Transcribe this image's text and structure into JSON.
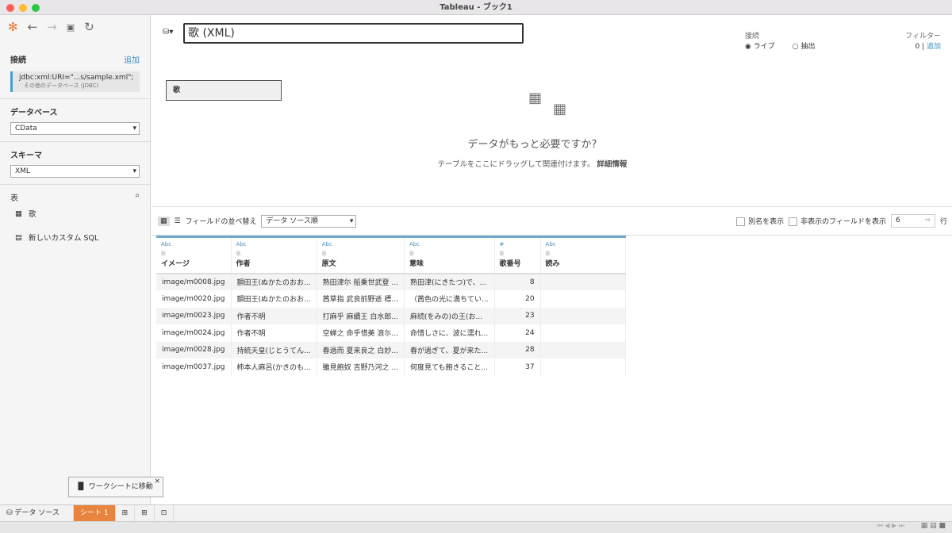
{
  "window": {
    "title": "Tableau - ブック1"
  },
  "sidebar": {
    "connections_label": "接続",
    "add_label": "追加",
    "connection": {
      "name": "jdbc:xml:URI=\"...s/sample.xml\";",
      "type": "その他のデータベース (JDBC)"
    },
    "database_label": "データベース",
    "database_value": "CData",
    "schema_label": "スキーマ",
    "schema_value": "XML",
    "tables_label": "表",
    "tables": [
      "歌"
    ],
    "custom_sql": "新しいカスタム SQL"
  },
  "canvas": {
    "datasource_name": "歌 (XML)",
    "table": "歌",
    "need_more": "データがもっと必要ですか?",
    "drag_hint": "テーブルをここにドラッグして関連付けます。",
    "learn_more": "詳細情報",
    "connection_label": "接続",
    "live": "ライブ",
    "extract": "抽出",
    "filter_label": "フィルター",
    "filter_count": "0",
    "filter_add": "追加"
  },
  "grid_toolbar": {
    "sort_label": "フィールドの並べ替え",
    "sort_value": "データ ソース順",
    "show_aliases": "別名を表示",
    "show_hidden": "非表示のフィールドを表示",
    "rows_value": "6",
    "rows_label": "行"
  },
  "grid": {
    "columns": [
      {
        "type": "Abc",
        "source": "歌",
        "name": "イメージ"
      },
      {
        "type": "Abc",
        "source": "歌",
        "name": "作者"
      },
      {
        "type": "Abc",
        "source": "歌",
        "name": "原文"
      },
      {
        "type": "Abc",
        "source": "歌",
        "name": "意味"
      },
      {
        "type": "#",
        "source": "歌",
        "name": "歌番号"
      },
      {
        "type": "Abc",
        "source": "歌",
        "name": "読み"
      }
    ],
    "rows": [
      [
        "image/m0008.jpg",
        "額田王(ぬかたのおお...",
        "熟田津尓 船乗世武登 ...",
        "熟田津(にきたつ)で、...",
        "8",
        ""
      ],
      [
        "image/m0020.jpg",
        "額田王(ぬかたのおお...",
        "茜草指 武良前野逝 標...",
        "（茜色の光に満ちてい...",
        "20",
        ""
      ],
      [
        "image/m0023.jpg",
        "作者不明",
        "打麻乎 麻續王 白水郎...",
        "麻続(をみの)の王(お...",
        "23",
        ""
      ],
      [
        "image/m0024.jpg",
        "作者不明",
        "空蝉之 命乎惜美 浪尓...",
        "命惜しさに、波に濡れ...",
        "24",
        ""
      ],
      [
        "image/m0028.jpg",
        "持統天皇(じとうてん...",
        "春過而 夏来良之 白妙...",
        "春が過ぎて、夏が来た...",
        "28",
        ""
      ],
      [
        "image/m0037.jpg",
        "柿本人麻呂(かきのも...",
        "雖見飽奴 吉野乃河之 ...",
        "何度見ても飽きること...",
        "37",
        ""
      ]
    ]
  },
  "tabs": {
    "datasource": "データ ソース",
    "sheet": "シート 1"
  },
  "tooltip": {
    "text": "ワークシートに移動"
  }
}
